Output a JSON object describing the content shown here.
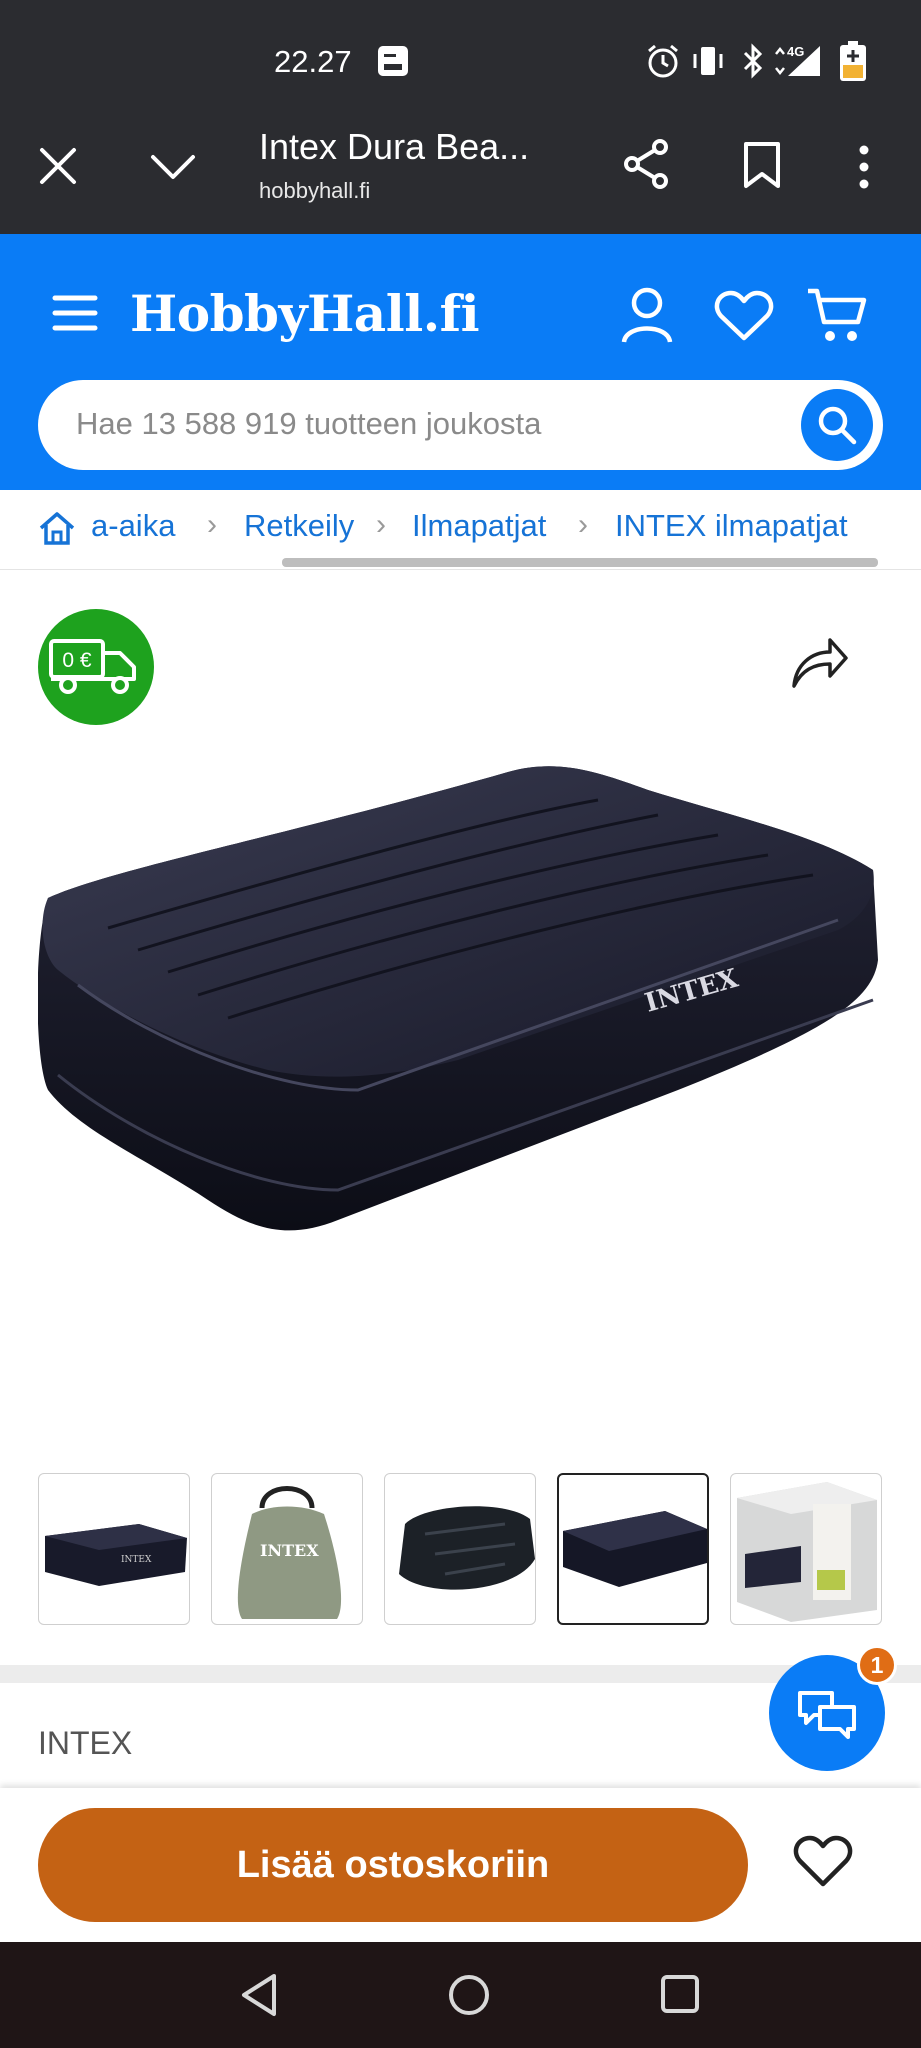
{
  "status_bar": {
    "time": "22.27",
    "network": "4G"
  },
  "browser": {
    "title": "Intex Dura Bea...",
    "url": "hobbyhall.fi"
  },
  "site": {
    "logo": "HobbyHall.fi",
    "search_placeholder": "Hae 13 588 919 tuotteen joukosta"
  },
  "breadcrumb": {
    "items": [
      "a-aika",
      "Retkeily",
      "Ilmapatjat",
      "INTEX ilmapatjat"
    ]
  },
  "product": {
    "delivery_badge": "0 €",
    "image_brand_print": "INTEX",
    "thumbnails": [
      {
        "name": "thumb-1",
        "selected": false
      },
      {
        "name": "thumb-2",
        "selected": false
      },
      {
        "name": "thumb-3",
        "selected": false
      },
      {
        "name": "thumb-4",
        "selected": true
      },
      {
        "name": "thumb-5",
        "selected": false
      }
    ],
    "brand": "INTEX"
  },
  "chat": {
    "badge_count": "1"
  },
  "action": {
    "add_to_cart": "Lisää ostoskoriin"
  },
  "colors": {
    "brand_blue": "#0a7cf6",
    "cta_orange": "#c46214",
    "delivery_green": "#1ea21e",
    "chrome_dark": "#2b2c30"
  }
}
